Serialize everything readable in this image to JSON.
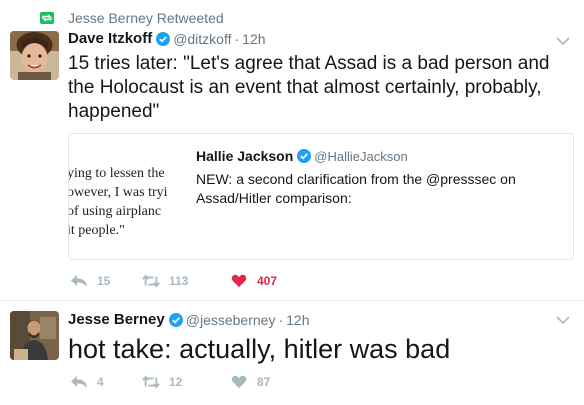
{
  "retweet_banner": {
    "text": "Jesse Berney Retweeted"
  },
  "tweet1": {
    "name": "Dave Itzkoff",
    "handle": "@ditzkoff",
    "separator": "·",
    "time": "12h",
    "text": "15 tries later: \"Let's agree that Assad is a bad person and the Holocaust is an event that almost certainly, probably, happened\"",
    "quote": {
      "image_lines": [
        "ying to lessen the",
        "owever, I was tryi",
        "of using airplanc",
        "it people.\""
      ],
      "name": "Hallie Jackson",
      "handle": "@HallieJackson",
      "text": "NEW: a second clarification from the @presssec on Assad/Hitler comparison:"
    },
    "actions": {
      "replies": "15",
      "retweets": "113",
      "likes": "407"
    }
  },
  "tweet2": {
    "name": "Jesse Berney",
    "handle": "@jesseberney",
    "separator": "·",
    "time": "12h",
    "text": "hot take: actually, hitler was bad",
    "actions": {
      "replies": "4",
      "retweets": "12",
      "likes": "87"
    }
  },
  "colors": {
    "retweet_green": "#17bf63",
    "verified_blue": "#1da1f2",
    "like_red": "#e2264d",
    "muted": "#657786",
    "icon_grey": "#aab8c2"
  }
}
